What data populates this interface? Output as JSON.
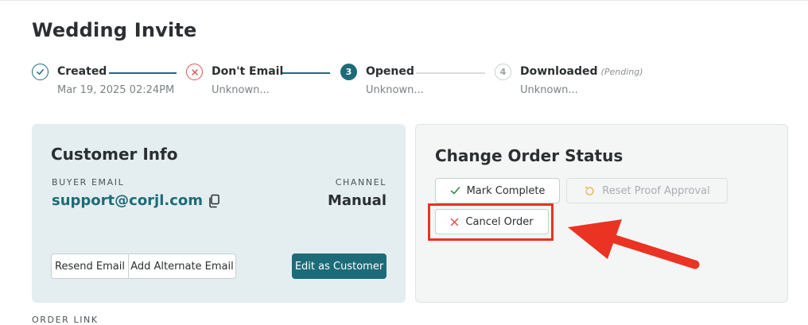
{
  "page": {
    "title": "Wedding Invite"
  },
  "steps": [
    {
      "title": "Created",
      "sub": "Mar 19, 2025 02:24PM",
      "marker": "check-icon"
    },
    {
      "title": "Don't Email",
      "sub": "Unknown...",
      "marker": "x-icon"
    },
    {
      "title": "Opened",
      "sub": "Unknown...",
      "number": "3"
    },
    {
      "title": "Downloaded",
      "pending_label": "(Pending)",
      "sub": "Unknown...",
      "number": "4"
    }
  ],
  "customer": {
    "title": "Customer Info",
    "buyer_email_label": "BUYER EMAIL",
    "buyer_email": "support@corjl.com",
    "channel_label": "CHANNEL",
    "channel": "Manual",
    "resend_label": "Resend Email",
    "alternate_label": "Add Alternate Email",
    "edit_label": "Edit as Customer"
  },
  "status": {
    "title": "Change Order Status",
    "mark_complete_label": "Mark Complete",
    "reset_proof_label": "Reset Proof Approval",
    "cancel_order_label": "Cancel Order"
  },
  "footer": {
    "order_link_label": "ORDER LINK"
  },
  "colors": {
    "accent": "#1d6b78",
    "error": "#d9534f",
    "highlight": "#ea3323",
    "customer_panel_bg": "#e4eef0"
  }
}
